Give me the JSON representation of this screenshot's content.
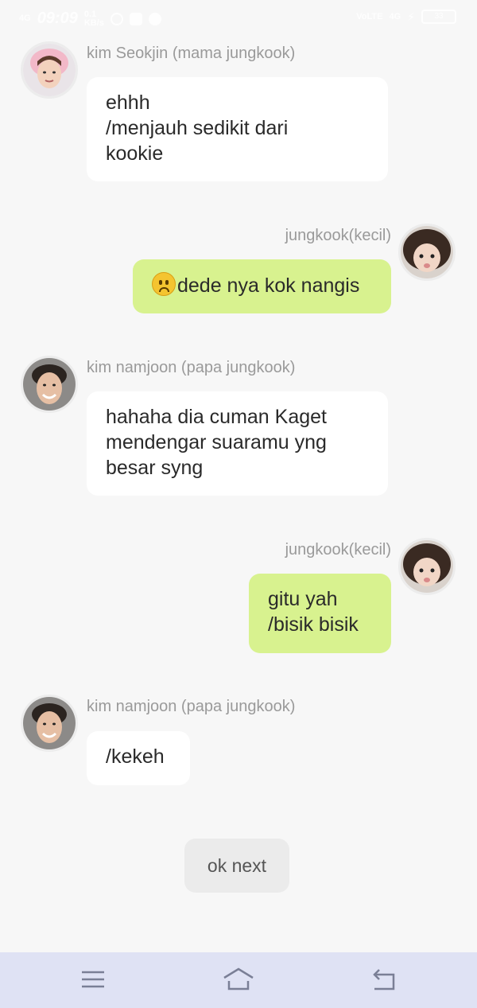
{
  "status_bar": {
    "net_left": "4G",
    "time": "09:09",
    "speed": "0.1\nKB/s",
    "net_right": "4G",
    "volte": "VoLTE",
    "battery": "33"
  },
  "messages": [
    {
      "side": "left",
      "sender": "kim Seokjin (mama jungkook)",
      "avatar": "avatar-seokjin",
      "text": "ehhh\n/menjauh sedikit dari\nkookie"
    },
    {
      "side": "right",
      "sender": "jungkook(kecil)",
      "avatar": "avatar-jungkook",
      "text": "dede nya kok nangis",
      "emoji": "worried-face-emoji"
    },
    {
      "side": "left",
      "sender": "kim namjoon (papa jungkook)",
      "avatar": "avatar-namjoon",
      "text": "hahaha dia cuman Kaget\nmendengar suaramu yng\nbesar syng"
    },
    {
      "side": "right",
      "sender": "jungkook(kecil)",
      "avatar": "avatar-jungkook",
      "text": "gitu yah\n/bisik bisik"
    },
    {
      "side": "left",
      "sender": "kim namjoon (papa jungkook)",
      "avatar": "avatar-namjoon",
      "text": "/kekeh"
    }
  ],
  "actions": {
    "next_label": "ok next"
  },
  "navbar": {
    "menu_icon": "menu-icon",
    "home_icon": "home-icon",
    "back_icon": "back-icon"
  },
  "colors": {
    "background": "#f7f7f7",
    "bubble_left": "#ffffff",
    "bubble_right": "#d8f28f",
    "navbar": "#dfe2f4"
  }
}
